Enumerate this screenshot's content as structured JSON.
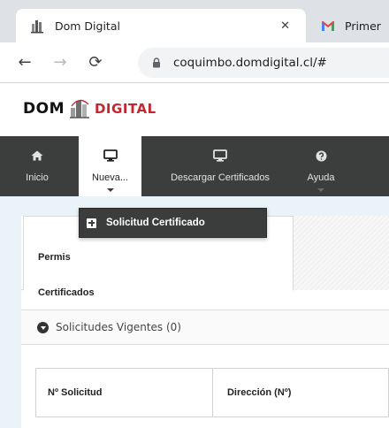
{
  "browser": {
    "active_tab_title": "Dom Digital",
    "close_glyph": "✕",
    "inactive_tab_title": "Primer",
    "url": "coquimbo.domdigital.cl/#"
  },
  "site": {
    "logo_left": "DOM",
    "logo_right": "DIGITAL"
  },
  "nav": {
    "items": [
      {
        "label": "Inicio",
        "icon": "home-icon"
      },
      {
        "label": "Nueva...",
        "icon": "monitor-icon"
      },
      {
        "label": "Descargar Certificados",
        "icon": "monitor-icon"
      },
      {
        "label": "Ayuda",
        "icon": "question-icon"
      }
    ],
    "dropdown_item": "Solicitud Certificado"
  },
  "content": {
    "tab_title": "Permis",
    "tab_subtitle": "Certificados",
    "section_toggle": "Solicitudes Vigentes (0)",
    "table_headers": [
      "Nº Solicitud",
      "Dirección (Nº)"
    ]
  },
  "colors": {
    "navbar": "#3c3d3d",
    "logo_red": "#c7262f",
    "content_bg": "#eaf3f7"
  }
}
